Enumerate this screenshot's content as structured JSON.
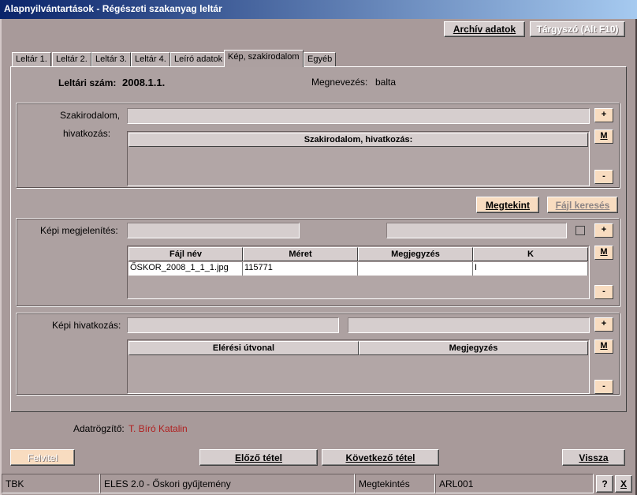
{
  "window": {
    "title": "Alapnyilvántartások - Régészeti szakanyag leltár"
  },
  "toolbar": {
    "archive_label": "Archív adatok",
    "subject_label": "Tárgyszó (Alt F10)"
  },
  "tabs": [
    "Leltár 1.",
    "Leltár 2.",
    "Leltár 3.",
    "Leltár 4.",
    "Leíró adatok",
    "Kép, szakirodalom",
    "Egyéb"
  ],
  "header": {
    "inv_label": "Leltári szám:",
    "inv_value": "2008.1.1.",
    "name_label": "Megnevezés:",
    "name_value": "balta"
  },
  "literature": {
    "label1": "Szakirodalom,",
    "label2": "hivatkozás:",
    "column": "Szakirodalom, hivatkozás:"
  },
  "side_buttons": {
    "add": "+",
    "modify": "M",
    "remove": "-"
  },
  "actions": {
    "view_label": "Megtekint",
    "file_search_label": "Fájl keresés"
  },
  "image_display": {
    "label": "Képi megjelenítés:",
    "columns": [
      "Fájl név",
      "Méret",
      "Megjegyzés",
      "K"
    ],
    "rows": [
      [
        "ŐSKOR_2008_1_1_1.jpg",
        "115771",
        "",
        "I"
      ]
    ]
  },
  "image_reference": {
    "label": "Képi hivatkozás:",
    "columns": [
      "Elérési útvonal",
      "Megjegyzés"
    ]
  },
  "recorder": {
    "label": "Adatrögzítő:",
    "value": "T. Bíró Katalin",
    "value_color": "#b02020"
  },
  "nav": {
    "add_label": "Felvitel",
    "prev_label": "Előző tétel",
    "next_label": "Következő tétel",
    "back_label": "Vissza"
  },
  "status": {
    "app": "TBK",
    "collection": "ELES 2.0 - Őskori gyűjtemény",
    "mode": "Megtekintés",
    "code": "ARL001",
    "help": "?",
    "close": "X"
  }
}
